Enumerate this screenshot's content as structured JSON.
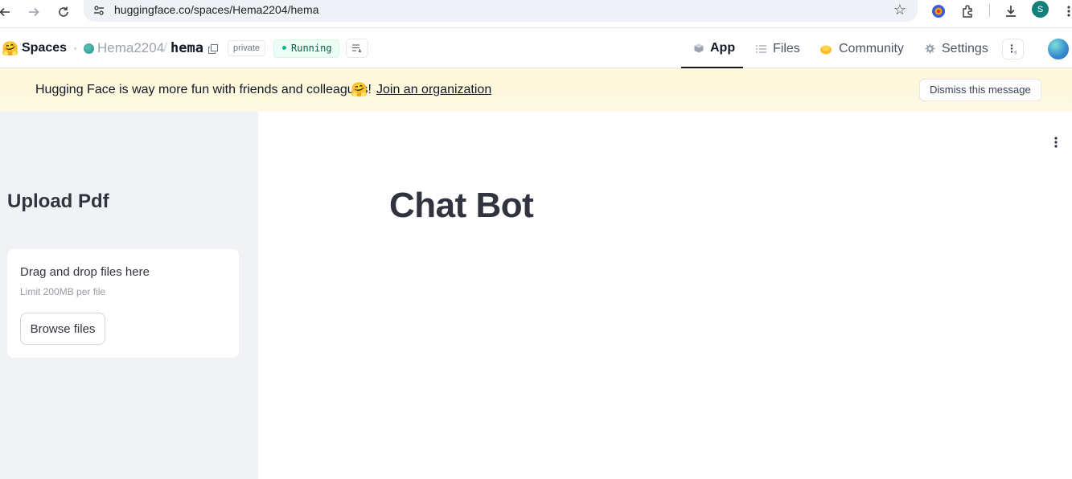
{
  "browser": {
    "url": "huggingface.co/spaces/Hema2204/hema",
    "profile_initial": "S"
  },
  "header": {
    "brand": "Spaces",
    "owner": "Hema2204",
    "separator": "/",
    "repo": "hema",
    "visibility": "private",
    "status": "Running",
    "tabs": [
      {
        "label": "App",
        "icon": "cube-icon",
        "active": true
      },
      {
        "label": "Files",
        "icon": "files-icon",
        "active": false
      },
      {
        "label": "Community",
        "icon": "community-icon",
        "active": false
      },
      {
        "label": "Settings",
        "icon": "gear-icon",
        "active": false
      }
    ]
  },
  "banner": {
    "text": "Hugging Face is way more fun with friends and colleagues!",
    "emoji": "🤗",
    "link": "Join an organization",
    "dismiss": "Dismiss this message"
  },
  "sidebar": {
    "title": "Upload Pdf",
    "uploader": {
      "drag_text": "Drag and drop files here",
      "limit_text": "Limit 200MB per file",
      "button": "Browse files"
    }
  },
  "main": {
    "title": "Chat Bot"
  },
  "colors": {
    "banner_bg": "#fff7d6",
    "sidebar_bg": "#f0f2f6",
    "running_green": "#10b981",
    "text_dark": "#31333f"
  }
}
